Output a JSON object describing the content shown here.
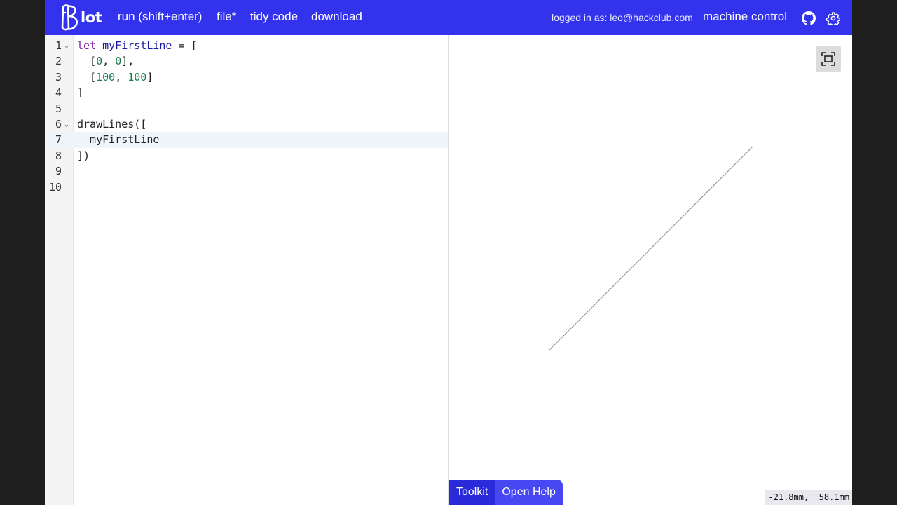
{
  "app": {
    "logo_text": "lot",
    "logo_letter": "B"
  },
  "nav": {
    "run": "run (shift+enter)",
    "file": "file*",
    "tidy": "tidy code",
    "download": "download",
    "logged_in": "logged in as: leo@hackclub.com",
    "machine_control": "machine control"
  },
  "icons": {
    "github": "github-icon",
    "settings": "gear-icon",
    "fit": "fit-to-screen-icon"
  },
  "editor": {
    "active_line": 7,
    "lines": [
      {
        "n": "1",
        "fold": true
      },
      {
        "n": "2",
        "fold": false
      },
      {
        "n": "3",
        "fold": false
      },
      {
        "n": "4",
        "fold": false
      },
      {
        "n": "5",
        "fold": false
      },
      {
        "n": "6",
        "fold": true
      },
      {
        "n": "7",
        "fold": false
      },
      {
        "n": "8",
        "fold": false
      },
      {
        "n": "9",
        "fold": false
      },
      {
        "n": "10",
        "fold": false
      }
    ],
    "code": {
      "l1_kw": "let",
      "l1_name": "myFirstLine",
      "l1_rest": " = [",
      "l2_open": "  [",
      "l2_a": "0",
      "l2_sep": ", ",
      "l2_b": "0",
      "l2_close": "],",
      "l3_open": "  [",
      "l3_a": "100",
      "l3_sep": ", ",
      "l3_b": "100",
      "l3_close": "]",
      "l4": "]",
      "l5": "",
      "l6": "drawLines([",
      "l7": "  myFirstLine",
      "l8": "])",
      "l9": "",
      "l10": ""
    }
  },
  "preview": {
    "line_from": [
      0,
      0
    ],
    "line_to": [
      100,
      100
    ],
    "line_color": "#888888"
  },
  "bottom": {
    "toolkit": "Toolkit",
    "help": "Open Help",
    "coords": "-21.8mm,  58.1mm"
  },
  "colors": {
    "topbar": "#3333ee",
    "keyword": "#7a1fa2",
    "definition": "#1a1aa6",
    "number": "#16794d"
  }
}
